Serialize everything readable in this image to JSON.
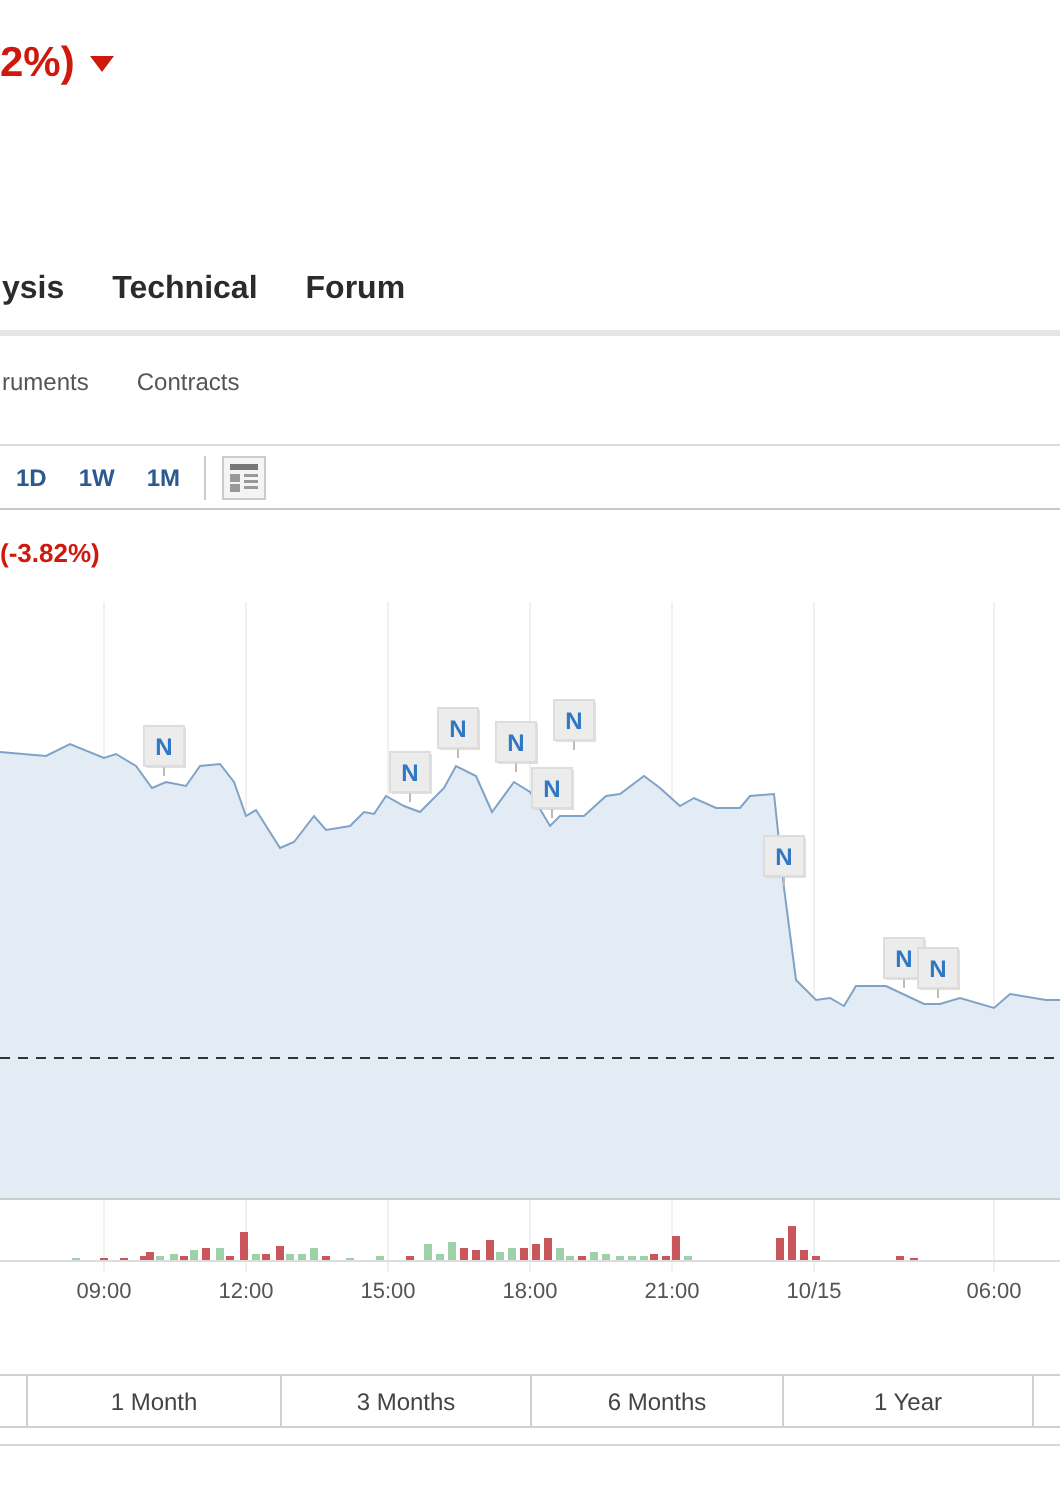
{
  "header": {
    "change_text": "2%)",
    "falling": true
  },
  "tabs": [
    {
      "label": "ysis"
    },
    {
      "label": "Technical"
    },
    {
      "label": "Forum"
    }
  ],
  "subnav": [
    {
      "label": "ruments"
    },
    {
      "label": "Contracts"
    }
  ],
  "intervals": [
    {
      "label": "1D"
    },
    {
      "label": "1W"
    },
    {
      "label": "1M"
    }
  ],
  "chart": {
    "change_text": "(-3.82%)",
    "news_markers": [
      {
        "label": "N"
      },
      {
        "label": "N"
      },
      {
        "label": "N"
      },
      {
        "label": "N"
      },
      {
        "label": "N"
      },
      {
        "label": "N"
      },
      {
        "label": "N"
      },
      {
        "label": "N"
      },
      {
        "label": "N"
      }
    ],
    "x_axis_labels": [
      "09:00",
      "12:00",
      "15:00",
      "18:00",
      "21:00",
      "10/15",
      "06:00"
    ]
  },
  "ranges": [
    {
      "label": "1 Month"
    },
    {
      "label": "3 Months"
    },
    {
      "label": "6 Months"
    },
    {
      "label": "1 Year"
    }
  ]
}
